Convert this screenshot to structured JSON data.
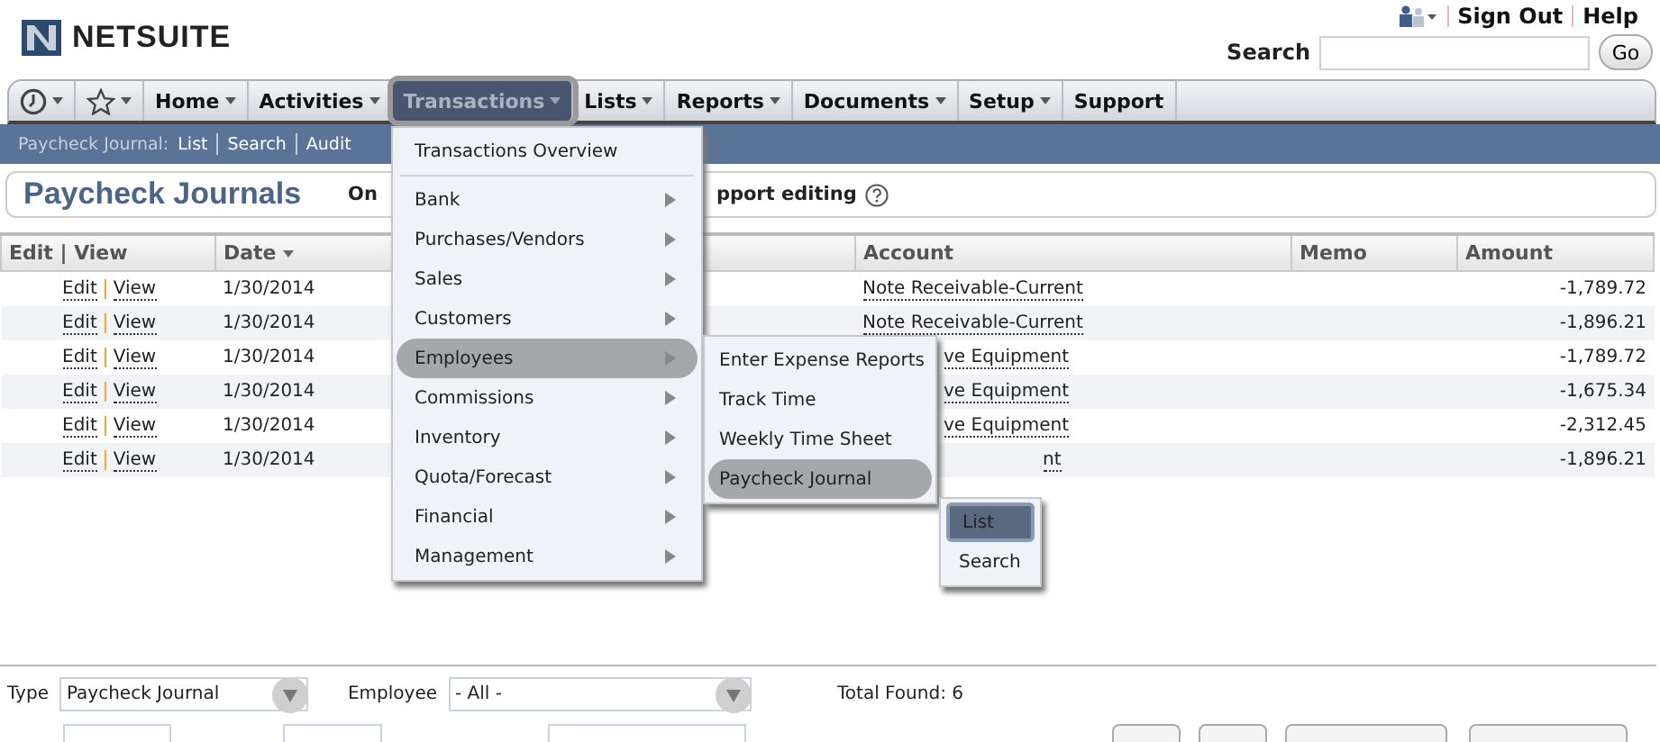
{
  "header": {
    "logo": "NETSUITE",
    "user_links": [
      "Sign Out",
      "Help"
    ],
    "search": {
      "label": "Search",
      "button": "Go"
    }
  },
  "nav": [
    {
      "kind": "clock",
      "selected": false
    },
    {
      "kind": "star",
      "selected": false
    },
    {
      "kind": "menu",
      "label": "Home",
      "selected": false
    },
    {
      "kind": "menu",
      "label": "Activities",
      "selected": false
    },
    {
      "kind": "menu",
      "label": "Transactions",
      "selected": true
    },
    {
      "kind": "menu",
      "label": "Lists",
      "selected": false
    },
    {
      "kind": "menu",
      "label": "Reports",
      "selected": false
    },
    {
      "kind": "menu",
      "label": "Documents",
      "selected": false
    },
    {
      "kind": "menu",
      "label": "Setup",
      "selected": false
    },
    {
      "kind": "link",
      "label": "Support",
      "selected": false
    }
  ],
  "subnav": {
    "label": "Paycheck Journal:",
    "links": [
      "List",
      "Search",
      "Audit"
    ]
  },
  "page_title": "Paycheck Journals",
  "notice_fragments": [
    "On",
    "pport editing"
  ],
  "table": {
    "columns": [
      "Edit | View",
      "Date",
      "Account",
      "Memo",
      "Amount"
    ],
    "rows": [
      {
        "edit": "Edit",
        "view": "View",
        "date": "1/30/2014",
        "account": "Note Receivable-Current",
        "amount": "-1,789.72"
      },
      {
        "edit": "Edit",
        "view": "View",
        "date": "1/30/2014",
        "account": "Note Receivable-Current",
        "amount": "-1,896.21"
      },
      {
        "edit": "Edit",
        "view": "View",
        "date": "1/30/2014",
        "account": "ve Equipment",
        "amount": "-1,789.72"
      },
      {
        "edit": "Edit",
        "view": "View",
        "date": "1/30/2014",
        "account": "ve Equipment",
        "amount": "-1,675.34"
      },
      {
        "edit": "Edit",
        "view": "View",
        "date": "1/30/2014",
        "account": "ve Equipment",
        "amount": "-2,312.45"
      },
      {
        "edit": "Edit",
        "view": "View",
        "date": "1/30/2014",
        "account": "nt",
        "amount": "-1,896.21"
      }
    ]
  },
  "menu": {
    "items": [
      {
        "kind": "link",
        "label": "Transactions Overview",
        "selected": false
      },
      {
        "kind": "submenu",
        "label": "Bank",
        "selected": false
      },
      {
        "kind": "submenu",
        "label": "Purchases/Vendors",
        "selected": false
      },
      {
        "kind": "submenu",
        "label": "Sales",
        "selected": false
      },
      {
        "kind": "submenu",
        "label": "Customers",
        "selected": false
      },
      {
        "kind": "submenu",
        "label": "Employees",
        "selected": true
      },
      {
        "kind": "submenu",
        "label": "Commissions",
        "selected": false
      },
      {
        "kind": "submenu",
        "label": "Inventory",
        "selected": false
      },
      {
        "kind": "submenu",
        "label": "Quota/Forecast",
        "selected": false
      },
      {
        "kind": "submenu",
        "label": "Financial",
        "selected": false
      },
      {
        "kind": "submenu",
        "label": "Management",
        "selected": false
      }
    ]
  },
  "submenu": {
    "items": [
      {
        "label": "Enter Expense Reports",
        "selected": false
      },
      {
        "label": "Track Time",
        "selected": false
      },
      {
        "label": "Weekly Time Sheet",
        "selected": false
      },
      {
        "label": "Paycheck Journal",
        "selected": true
      }
    ]
  },
  "subsubmenu": {
    "items": [
      {
        "label": "List",
        "selected": true
      },
      {
        "label": "Search",
        "selected": false
      }
    ]
  },
  "filters": {
    "type_label": "Type",
    "type_value": "Paycheck Journal",
    "employee_label": "Employee",
    "employee_value": "- All -",
    "total": "Total Found: 6"
  }
}
